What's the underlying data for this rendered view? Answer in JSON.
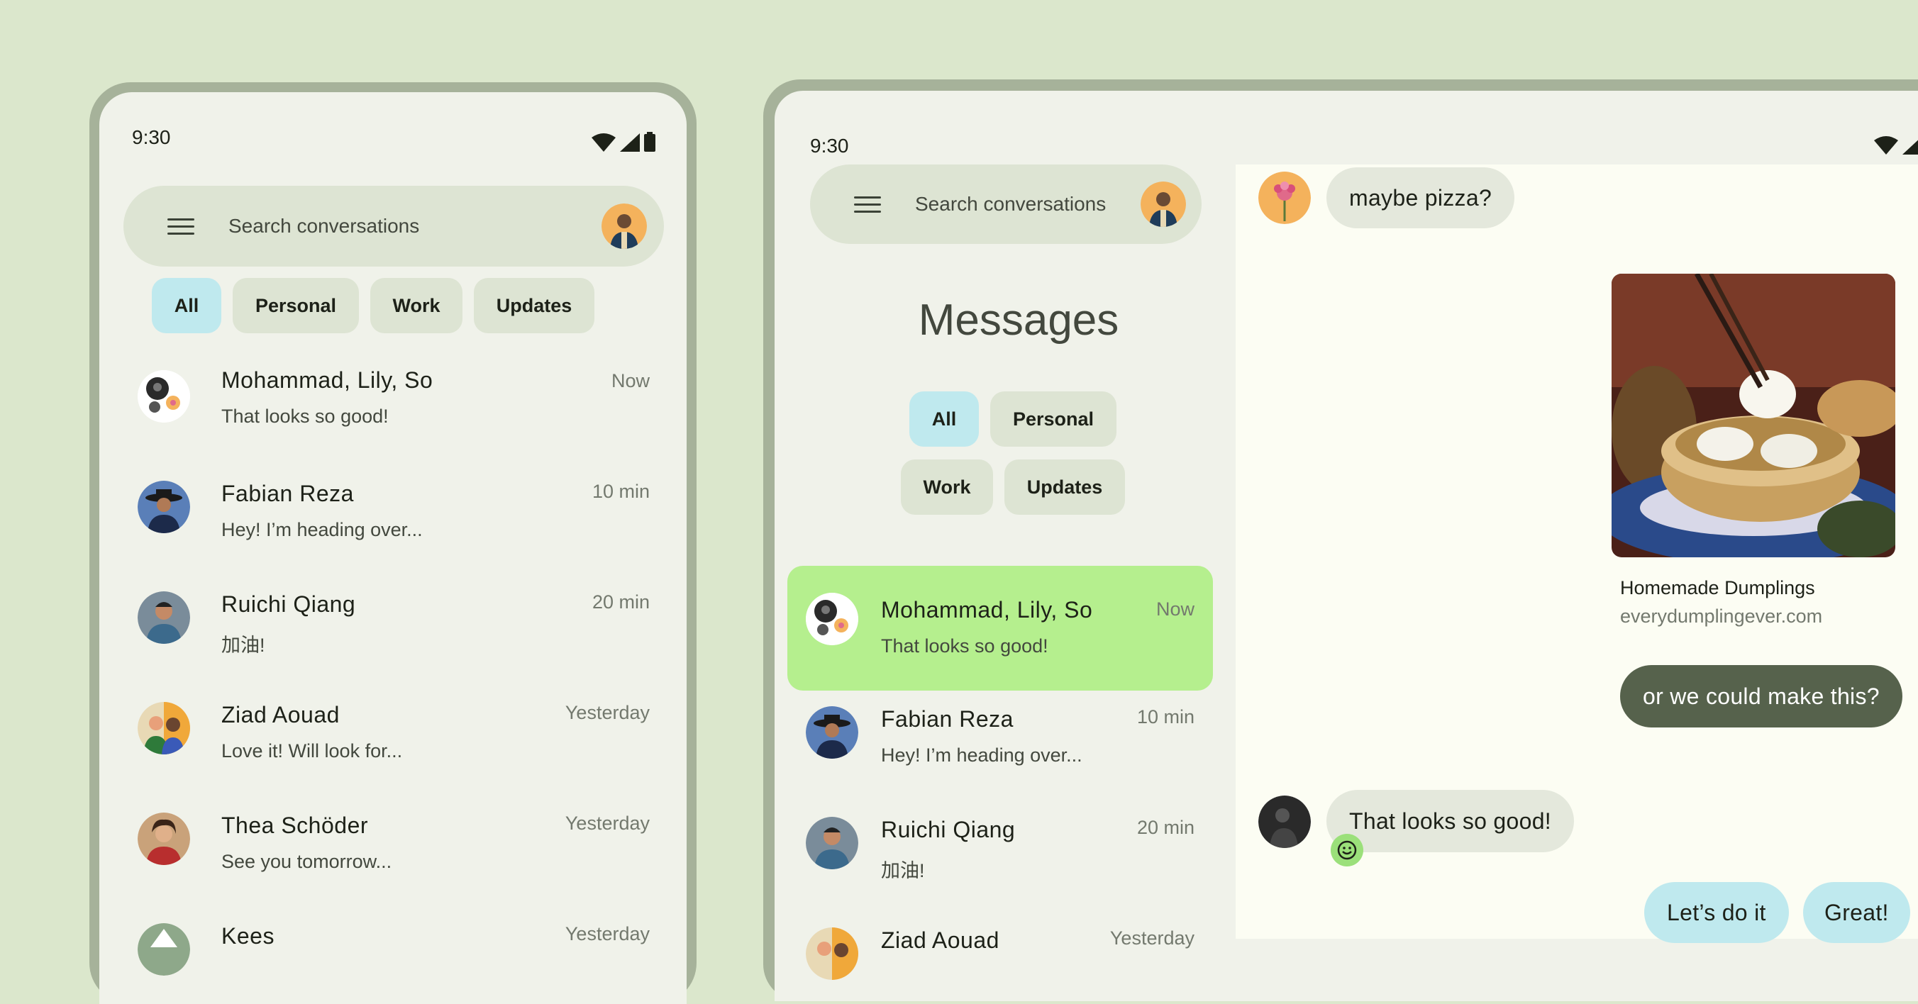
{
  "status": {
    "time": "9:30"
  },
  "phone": {
    "search_placeholder": "Search conversations",
    "chips": [
      "All",
      "Personal",
      "Work",
      "Updates"
    ],
    "conversations": [
      {
        "name": "Mohammad, Lily, So",
        "preview": "That looks so good!",
        "time": "Now"
      },
      {
        "name": "Fabian Reza",
        "preview": "Hey! I’m heading over...",
        "time": "10 min"
      },
      {
        "name": "Ruichi Qiang",
        "preview": "加油!",
        "time": "20 min"
      },
      {
        "name": "Ziad Aouad",
        "preview": "Love it! Will look for...",
        "time": "Yesterday"
      },
      {
        "name": "Thea Schöder",
        "preview": "See you tomorrow...",
        "time": "Yesterday"
      },
      {
        "name": "Kees",
        "preview": "",
        "time": "Yesterday"
      }
    ]
  },
  "tablet": {
    "search_placeholder": "Search conversations",
    "title": "Messages",
    "chips": [
      "All",
      "Personal",
      "Work",
      "Updates"
    ],
    "conversations": [
      {
        "name": "Mohammad, Lily, So",
        "preview": "That looks so good!",
        "time": "Now"
      },
      {
        "name": "Fabian Reza",
        "preview": "Hey! I’m heading over...",
        "time": "10 min"
      },
      {
        "name": "Ruichi Qiang",
        "preview": "加油!",
        "time": "20 min"
      },
      {
        "name": "Ziad Aouad",
        "preview": "",
        "time": "Yesterday"
      }
    ],
    "chat": {
      "msg_pizza": "maybe pizza?",
      "link_title": "Homemade Dumplings",
      "link_url": "everydumplingever.com",
      "msg_make": "or we could make this?",
      "msg_looks": "That looks so good!",
      "msg_lets": "Let’s do it",
      "msg_great": "Great!"
    }
  },
  "colors": {
    "background": "#dbe7cc",
    "selected_chip": "#bfe9ee",
    "selected_conversation": "#b5ef8e",
    "outgoing_dark": "#56624c",
    "outgoing_light": "#bfe9ee"
  }
}
